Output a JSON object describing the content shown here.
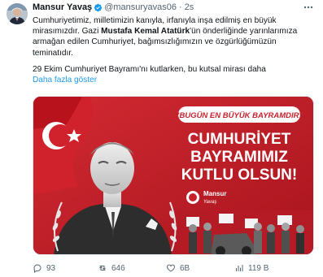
{
  "author": {
    "display_name": "Mansur Yavaş",
    "handle": "@mansuryavas06",
    "separator": "·",
    "time": "2s"
  },
  "tweet": {
    "paragraph_1_part_1": "Cumhuriyetimiz, milletimizin kanıyla, irfanıyla inşa edilmiş en büyük mirasımızdır. Gazi ",
    "paragraph_1_bold": "Mustafa Kemal Atatürk",
    "paragraph_1_part_2": "'ün önderliğinde yarınlarımıza armağan edilen Cumhuriyet, bağımsızlığımızın ve özgürlüğümüzün teminatıdır.",
    "paragraph_2": "29 Ekim Cumhuriyet Bayramı'nı kutlarken, bu kutsal mirası daha",
    "show_more": "Daha fazla göster"
  },
  "media": {
    "banner_text": "\"BUGÜN EN BÜYÜK BAYRAMDIR\"",
    "headline_line1": "CUMHURİYET",
    "headline_line2": "BAYRAMIMIZ",
    "headline_line3": "KUTLU OLSUN!",
    "logo_name": "Mansur",
    "logo_sub": "Yavaş",
    "colors": {
      "red": "#c8202b",
      "dark_red": "#8e1119",
      "white": "#ffffff"
    }
  },
  "actions": {
    "replies": "93",
    "retweets": "646",
    "likes": "6B",
    "views": "119 B"
  },
  "icons": {
    "verified": "verified-badge-icon",
    "more": "more-options-icon",
    "reply": "reply-icon",
    "retweet": "retweet-icon",
    "like": "heart-icon",
    "views": "views-chart-icon"
  }
}
